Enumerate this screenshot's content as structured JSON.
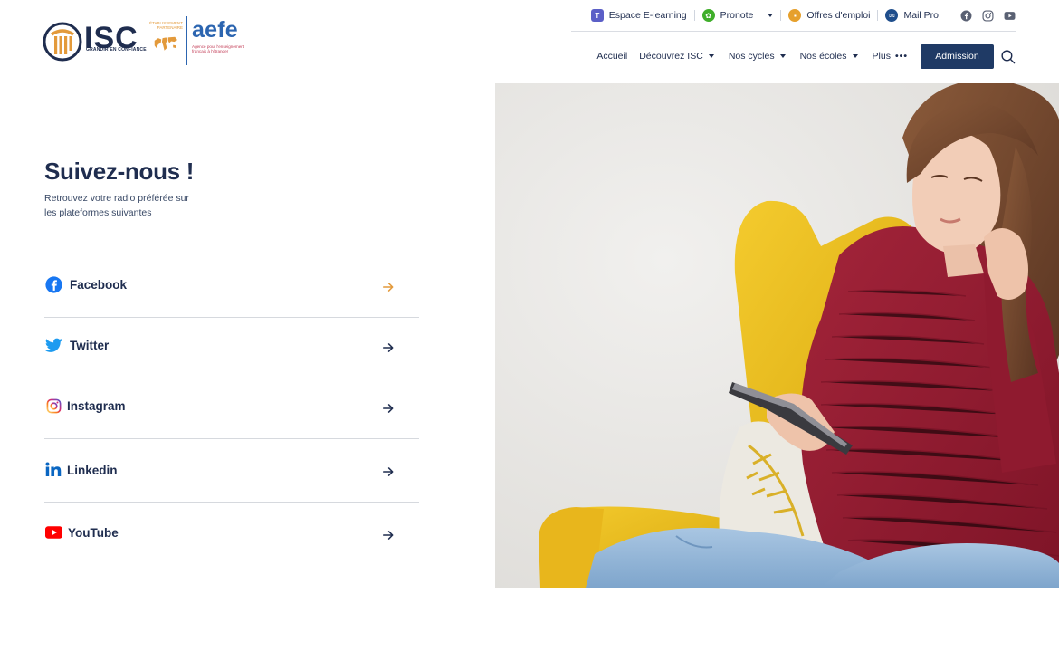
{
  "logo": {
    "isc_text": "ISC",
    "isc_tagline": "GRANDIR EN CONFIANCE",
    "partner_label": "ÉTABLISSEMENT PARTENAIRE",
    "aefe_text": "aefe",
    "aefe_sub": "Agence pour l'enseignement français à l'étranger"
  },
  "topbar": {
    "items": [
      {
        "label": "Espace E-learning",
        "icon": "teams-icon"
      },
      {
        "label": "Pronote",
        "icon": "pronote-icon",
        "dropdown": true
      },
      {
        "label": "Offres d'emploi",
        "icon": "briefcase-icon"
      },
      {
        "label": "Mail Pro",
        "icon": "mail-icon"
      }
    ],
    "social": [
      "facebook-icon",
      "instagram-icon",
      "youtube-icon"
    ]
  },
  "nav": {
    "items": [
      {
        "label": "Accueil"
      },
      {
        "label": "Découvrez ISC",
        "dropdown": true
      },
      {
        "label": "Nos cycles",
        "dropdown": true
      },
      {
        "label": "Nos écoles",
        "dropdown": true
      },
      {
        "label": "Plus",
        "dots": "•••"
      }
    ],
    "cta": "Admission"
  },
  "main": {
    "title": "Suivez-nous !",
    "subtitle": "Retrouvez votre radio préférée sur les plateformes suivantes",
    "links": [
      {
        "label": "Facebook",
        "icon": "facebook-icon",
        "color": "#1877f2",
        "arrow_color": "#e39a3b"
      },
      {
        "label": "Twitter",
        "icon": "twitter-icon",
        "color": "#1d9bf0",
        "arrow_color": "#1f2d4f"
      },
      {
        "label": "Instagram",
        "icon": "instagram-icon",
        "color": "#d62976",
        "arrow_color": "#1f2d4f"
      },
      {
        "label": "Linkedin",
        "icon": "linkedin-icon",
        "color": "#0a66c2",
        "arrow_color": "#1f2d4f"
      },
      {
        "label": "YouTube",
        "icon": "youtube-icon",
        "color": "#ff0000",
        "arrow_color": "#1f2d4f"
      }
    ]
  },
  "colors": {
    "navy": "#1f2d4f",
    "button": "#1f3a65",
    "accent_orange": "#e39a3b",
    "aefe_blue": "#2c65b0"
  },
  "hero": {
    "image": "girl-in-red-sweater-on-yellow-armchair-with-phone"
  }
}
